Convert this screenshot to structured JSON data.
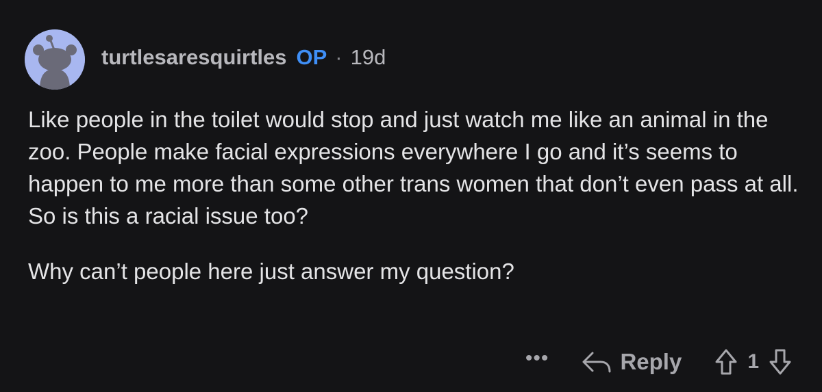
{
  "comment": {
    "author": "turtlesaresquirtles",
    "op_badge": "OP",
    "separator": "·",
    "age": "19d",
    "paragraphs": [
      "Like people in the toilet would stop and just watch me like an animal in the zoo. People make facial expressions everywhere I go and it’s seems to happen to me more than some other trans women that don’t even pass at all. So is this a racial issue too?",
      "Why can’t people here just answer my question?"
    ]
  },
  "actions": {
    "more_label": "•••",
    "reply_label": "Reply",
    "score": "1"
  },
  "icons": {
    "avatar": "reddit-snoo-avatar",
    "reply": "reply-arrow-icon",
    "upvote": "upvote-arrow-icon",
    "downvote": "downvote-arrow-icon"
  },
  "colors": {
    "background": "#141416",
    "op_badge": "#3f8ff7",
    "avatar_bg": "#a8b7f0"
  }
}
